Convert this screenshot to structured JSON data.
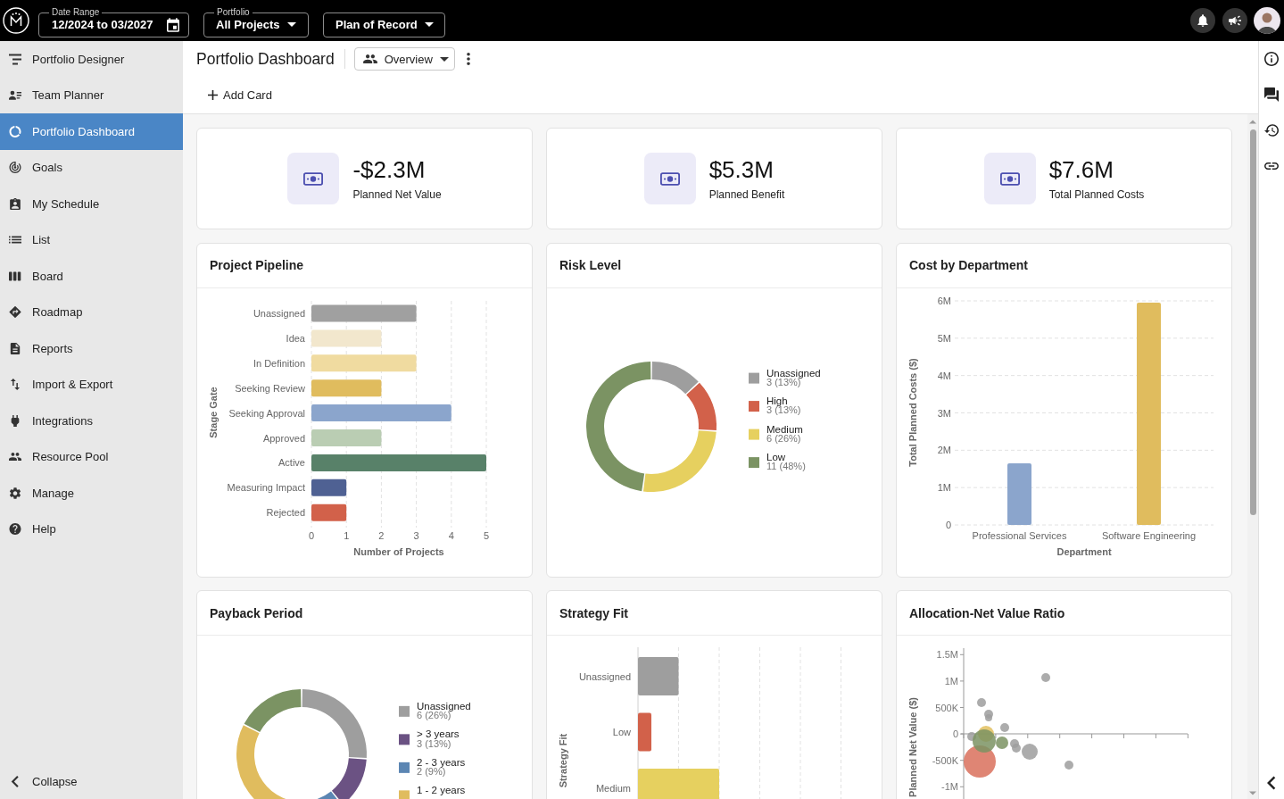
{
  "top_bar": {
    "date_range": {
      "label": "Date Range",
      "value": "12/2024 to 03/2027"
    },
    "portfolio": {
      "label": "Portfolio",
      "value": "All Projects"
    },
    "scenario": {
      "value": "Plan of Record"
    }
  },
  "sidebar": {
    "items": [
      {
        "label": "Portfolio Designer",
        "selected": false
      },
      {
        "label": "Team Planner",
        "selected": false
      },
      {
        "label": "Portfolio Dashboard",
        "selected": true
      },
      {
        "label": "Goals",
        "selected": false
      },
      {
        "label": "My Schedule",
        "selected": false
      },
      {
        "label": "List",
        "selected": false
      },
      {
        "label": "Board",
        "selected": false
      },
      {
        "label": "Roadmap",
        "selected": false
      },
      {
        "label": "Reports",
        "selected": false
      },
      {
        "label": "Import & Export",
        "selected": false
      },
      {
        "label": "Integrations",
        "selected": false
      },
      {
        "label": "Resource Pool",
        "selected": false
      },
      {
        "label": "Manage",
        "selected": false
      },
      {
        "label": "Help",
        "selected": false
      }
    ],
    "collapse": "Collapse"
  },
  "header": {
    "title": "Portfolio Dashboard",
    "view": "Overview",
    "add_card": "Add Card"
  },
  "kpis": [
    {
      "value": "-$2.3M",
      "label": "Planned Net Value"
    },
    {
      "value": "$5.3M",
      "label": "Planned Benefit"
    },
    {
      "value": "$7.6M",
      "label": "Total Planned Costs"
    }
  ],
  "charts": [
    {
      "title": "Project Pipeline",
      "chart_data": {
        "type": "bar",
        "orientation": "horizontal",
        "grid": true,
        "xlabel": "Number of Projects",
        "ylabel": "Stage Gate",
        "categories": [
          "Unassigned",
          "Idea",
          "In Definition",
          "Seeking Review",
          "Seeking Approval",
          "Approved",
          "Active",
          "Measuring Impact",
          "Rejected"
        ],
        "values": [
          3,
          2,
          3,
          2,
          4,
          2,
          5,
          1,
          1
        ],
        "colors": [
          "#a0a0a0",
          "#f2e7cd",
          "#f0dba0",
          "#e0bc5e",
          "#8ba5cc",
          "#bacdb3",
          "#588169",
          "#4f6193",
          "#d2614a"
        ],
        "xlim": [
          0,
          5
        ],
        "xticks": [
          0,
          1,
          2,
          3,
          4,
          5
        ]
      }
    },
    {
      "title": "Risk Level",
      "chart_data": {
        "type": "donut",
        "legend": "right",
        "categories": [
          "Unassigned",
          "High",
          "Medium",
          "Low"
        ],
        "values": [
          3,
          3,
          6,
          11
        ],
        "colors": [
          "#9e9e9e",
          "#d2614a",
          "#e6d05f",
          "#7b9363"
        ],
        "value_labels": [
          "3 (13%)",
          "3 (13%)",
          "6 (26%)",
          "11 (48%)"
        ]
      }
    },
    {
      "title": "Cost by Department",
      "chart_data": {
        "type": "bar",
        "orientation": "vertical",
        "grid": true,
        "xlabel": "Department",
        "ylabel": "Total Planned Costs ($)",
        "categories": [
          "Professional Services",
          "Software Engineering"
        ],
        "values": [
          1650000,
          5950000
        ],
        "colors": [
          "#8ba5cc",
          "#e0bc5e"
        ],
        "ylim": [
          0,
          6000000
        ],
        "yticks": [
          {
            "value": 0,
            "label": "0"
          },
          {
            "value": 1000000,
            "label": "1M"
          },
          {
            "value": 2000000,
            "label": "2M"
          },
          {
            "value": 3000000,
            "label": "3M"
          },
          {
            "value": 4000000,
            "label": "4M"
          },
          {
            "value": 5000000,
            "label": "5M"
          },
          {
            "value": 6000000,
            "label": "6M"
          }
        ]
      }
    },
    {
      "title": "Payback Period",
      "chart_data": {
        "type": "donut",
        "legend": "right",
        "categories": [
          "Unassigned",
          "> 3 years",
          "2 - 3 years",
          "1 - 2 years",
          null
        ],
        "values": [
          6,
          3,
          2,
          8,
          4
        ],
        "colors": [
          "#9e9e9e",
          "#6b5283",
          "#5c86b3",
          "#e0bc5e",
          "#7b9363"
        ],
        "value_labels": [
          "6 (26%)",
          "3 (13%)",
          "2 (9%)",
          null,
          null
        ]
      }
    },
    {
      "kind": "barpicture",
      "title": "Strategy Fit",
      "ylabel": "Strategy Fit",
      "bars": [
        {
          "label": "Unassigned",
          "color": "#9e9e9e"
        },
        {
          "label": "Low",
          "color": "#d2614a"
        },
        {
          "label": "Medium",
          "color": "#e6d05f"
        }
      ]
    },
    {
      "kind": "bubbles",
      "title": "Allocation-Net Value Ratio",
      "ylabel": "Planned Net Value ($)",
      "y_tick_labels": [
        "1.5M",
        "1M",
        "500K",
        "0",
        "-500K",
        "-1M"
      ]
    }
  ]
}
